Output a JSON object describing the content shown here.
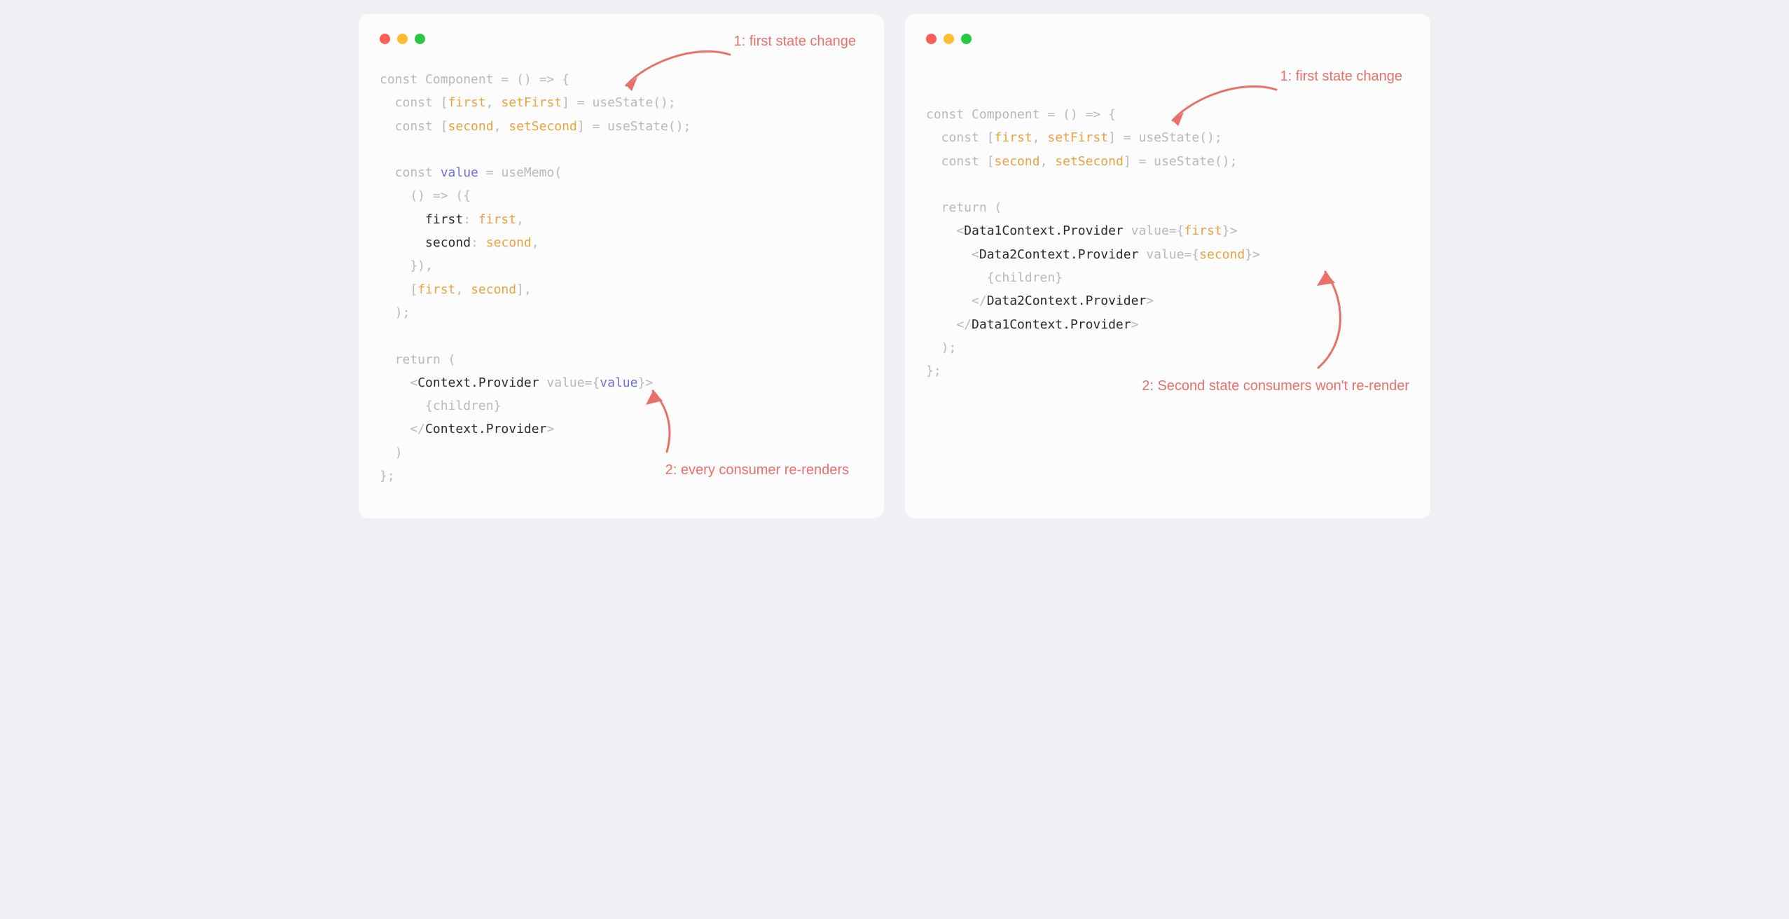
{
  "left": {
    "annotation1": "1: first state change",
    "annotation2": "2: every consumer re-renders",
    "code": {
      "l1a": "const",
      "l1b": " Component = () => {",
      "l2a": "  const",
      "l2b": " [",
      "l2c": "first",
      "l2d": ", ",
      "l2e": "setFirst",
      "l2f": "] = useState();",
      "l3a": "  const",
      "l3b": " [",
      "l3c": "second",
      "l3d": ", ",
      "l3e": "setSecond",
      "l3f": "] = useState();",
      "blank1": "",
      "l4a": "  const",
      "l4b": " ",
      "l4c": "value",
      "l4d": " = useMemo(",
      "l5": "    () => ({",
      "l6a": "      first",
      "l6b": ": ",
      "l6c": "first",
      "l6d": ",",
      "l7a": "      second",
      "l7b": ": ",
      "l7c": "second",
      "l7d": ",",
      "l8": "    }),",
      "l9a": "    [",
      "l9b": "first",
      "l9c": ", ",
      "l9d": "second",
      "l9e": "],",
      "l10": "  );",
      "blank2": "",
      "l11": "  return (",
      "l12a": "    <",
      "l12b": "Context.Provider",
      "l12c": " value",
      "l12d": "={",
      "l12e": "value",
      "l12f": "}>",
      "l13": "      {children}",
      "l14a": "    </",
      "l14b": "Context.Provider",
      "l14c": ">",
      "l15": "  )",
      "l16": "};"
    }
  },
  "right": {
    "annotation1": "1: first state change",
    "annotation2": "2: Second state consumers won't re-render",
    "code": {
      "l1a": "const",
      "l1b": " Component = () => {",
      "l2a": "  const",
      "l2b": " [",
      "l2c": "first",
      "l2d": ", ",
      "l2e": "setFirst",
      "l2f": "] = useState();",
      "l3a": "  const",
      "l3b": " [",
      "l3c": "second",
      "l3d": ", ",
      "l3e": "setSecond",
      "l3f": "] = useState();",
      "blank1": "",
      "l4": "  return (",
      "l5a": "    <",
      "l5b": "Data1Context.Provider",
      "l5c": " value",
      "l5d": "={",
      "l5e": "first",
      "l5f": "}>",
      "l6a": "      <",
      "l6b": "Data2Context.Provider",
      "l6c": " value",
      "l6d": "={",
      "l6e": "second",
      "l6f": "}>",
      "l7": "        {children}",
      "l8a": "      </",
      "l8b": "Data2Context.Provider",
      "l8c": ">",
      "l9a": "    </",
      "l9b": "Data1Context.Provider",
      "l9c": ">",
      "l10": "  );",
      "l11": "};"
    }
  }
}
